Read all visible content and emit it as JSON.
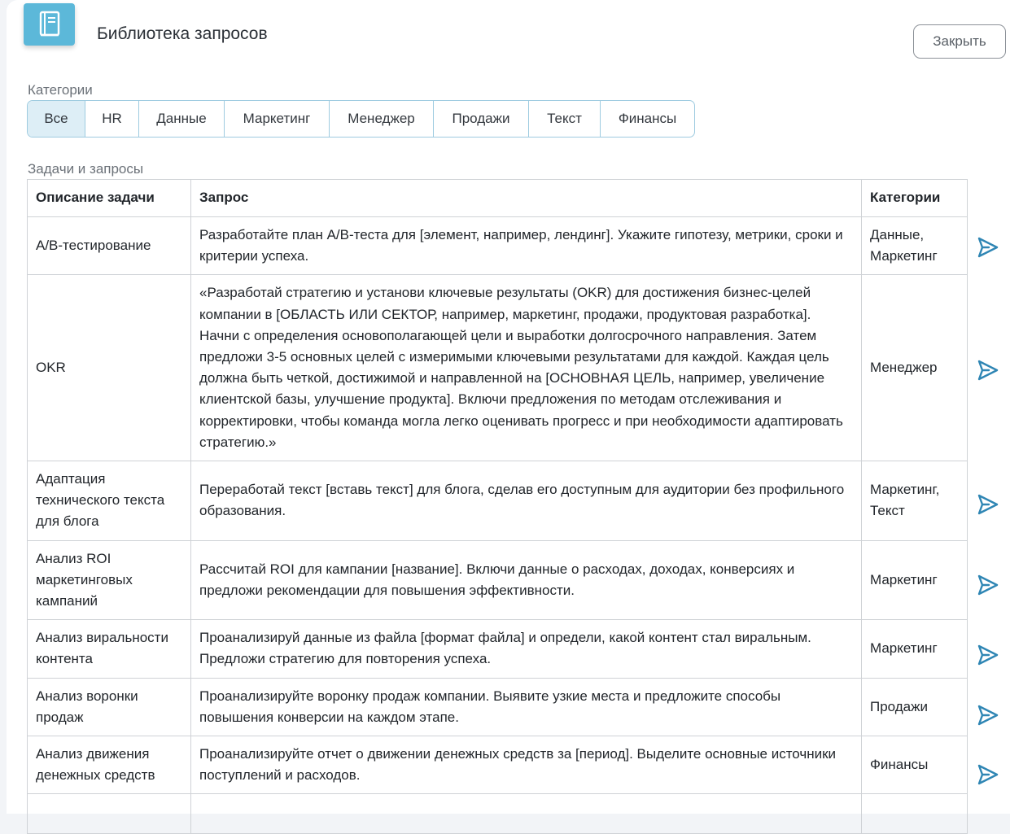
{
  "header": {
    "title": "Библиотека запросов",
    "close_label": "Закрыть",
    "icon": "book-icon"
  },
  "categories": {
    "label": "Категории",
    "items": [
      "Все",
      "HR",
      "Данные",
      "Маркетинг",
      "Менеджер",
      "Продажи",
      "Текст",
      "Финансы"
    ],
    "active": "Все"
  },
  "tasks": {
    "label": "Задачи и запросы",
    "columns": [
      "Описание задачи",
      "Запрос",
      "Категории"
    ],
    "rows": [
      {
        "task": "A/B-тестирование",
        "prompt": "Разработайте план A/B-теста для [элемент, например, лендинг]. Укажите гипотезу, метрики, сроки и критерии успеха.",
        "category": "Данные, Маркетинг"
      },
      {
        "task": "OKR",
        "prompt": "«Разработай стратегию и установи ключевые результаты (OKR) для достижения бизнес-целей компании в [ОБЛАСТЬ ИЛИ СЕКТОР, например, маркетинг, продажи, продуктовая разработка]. Начни с определения основополагающей цели и выработки долгосрочного направления. Затем предложи 3-5 основных целей с измеримыми ключевыми результатами для каждой. Каждая цель должна быть четкой, достижимой и направленной на [ОСНОВНАЯ ЦЕЛЬ, например, увеличение клиентской базы, улучшение продукта]. Включи предложения по методам отслеживания и корректировки, чтобы команда могла легко оценивать прогресс и при необходимости адаптировать стратегию.»",
        "category": "Менеджер"
      },
      {
        "task": "Адаптация технического текста для блога",
        "prompt": "Переработай текст [вставь текст] для блога, сделав его доступным для аудитории без профильного образования.",
        "category": "Маркетинг, Текст"
      },
      {
        "task": "Анализ ROI маркетинговых кампаний",
        "prompt": "Рассчитай ROI для кампании [название]. Включи данные о расходах, доходах, конверсиях и предложи рекомендации для повышения эффективности.",
        "category": "Маркетинг"
      },
      {
        "task": "Анализ виральности контента",
        "prompt": "Проанализируй данные из файла [формат файла] и определи, какой контент стал виральным. Предложи стратегию для повторения успеха.",
        "category": "Маркетинг"
      },
      {
        "task": "Анализ воронки продаж",
        "prompt": "Проанализируйте воронку продаж компании. Выявите узкие места и предложите способы повышения конверсии на каждом этапе.",
        "category": "Продажи"
      },
      {
        "task": "Анализ движения денежных средств",
        "prompt": "Проанализируйте отчет о движении денежных средств за [период]. Выделите основные источники поступлений и расходов.",
        "category": "Финансы"
      }
    ]
  },
  "colors": {
    "accent": "#2f86b4",
    "logo_bg": "#5cb8d9",
    "active_tab_bg": "#ddeef6"
  },
  "row_action_icon": "send-icon"
}
